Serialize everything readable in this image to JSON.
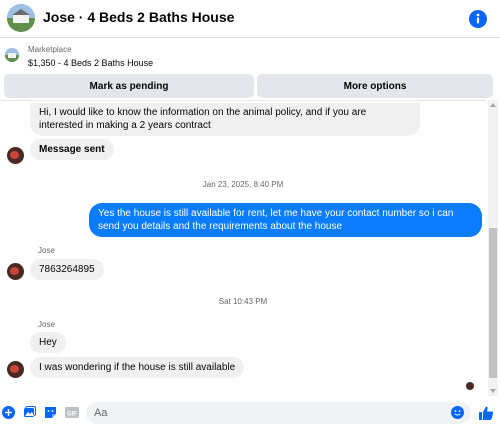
{
  "header": {
    "title": "Jose · 4 Beds 2 Baths House",
    "info_icon": "info-icon",
    "accent": "#0866ff"
  },
  "listing": {
    "label": "Marketplace",
    "price_title": "$1,350 - 4 Beds 2 Baths House"
  },
  "actions": {
    "mark_pending": "Mark as pending",
    "more_options": "More options"
  },
  "thread": {
    "messages": [
      {
        "from": "contact",
        "text": "Hi, I would like to know the information on the animal policy, and if you are interested in making a 2 years contract"
      },
      {
        "from": "contact",
        "text": "Message sent"
      },
      {
        "type": "timestamp",
        "text": "Jan 23, 2025, 8:40 PM"
      },
      {
        "from": "me",
        "text": "Yes the house is still available for rent, let me have your contact number so i can send you details and the requirements about the house"
      },
      {
        "type": "sender",
        "text": "Jose"
      },
      {
        "from": "contact",
        "text": "7863264895"
      },
      {
        "type": "timestamp",
        "text": "Sat 10:43 PM"
      },
      {
        "type": "sender",
        "text": "Jose"
      },
      {
        "from": "contact",
        "text": "Hey"
      },
      {
        "from": "contact",
        "text": "I was wondering if the house is still available"
      }
    ],
    "outgoing_color": "#0a7cff",
    "incoming_color": "#f0f0f0"
  },
  "composer": {
    "placeholder": "Aa",
    "icons": [
      "plus-icon",
      "image-icon",
      "sticker-icon",
      "gif-icon",
      "emoji-icon",
      "thumbs-up-icon"
    ],
    "gif_label": "GIF"
  }
}
